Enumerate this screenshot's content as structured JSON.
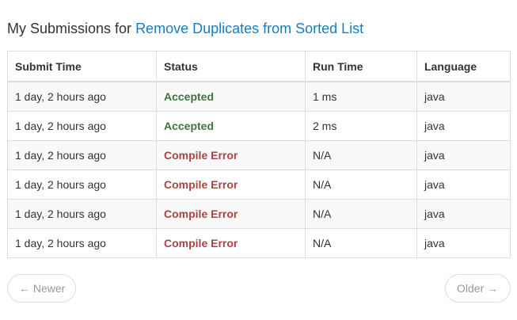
{
  "heading": {
    "prefix": "My Submissions for",
    "problem_title": "Remove Duplicates from Sorted List"
  },
  "table": {
    "columns": [
      "Submit Time",
      "Status",
      "Run Time",
      "Language"
    ],
    "rows": [
      {
        "submit_time": "1 day, 2 hours ago",
        "status": "Accepted",
        "run_time": "1 ms",
        "language": "java"
      },
      {
        "submit_time": "1 day, 2 hours ago",
        "status": "Accepted",
        "run_time": "2 ms",
        "language": "java"
      },
      {
        "submit_time": "1 day, 2 hours ago",
        "status": "Compile Error",
        "run_time": "N/A",
        "language": "java"
      },
      {
        "submit_time": "1 day, 2 hours ago",
        "status": "Compile Error",
        "run_time": "N/A",
        "language": "java"
      },
      {
        "submit_time": "1 day, 2 hours ago",
        "status": "Compile Error",
        "run_time": "N/A",
        "language": "java"
      },
      {
        "submit_time": "1 day, 2 hours ago",
        "status": "Compile Error",
        "run_time": "N/A",
        "language": "java"
      }
    ]
  },
  "pager": {
    "newer_label": "← Newer",
    "older_label": "Older →"
  },
  "colors": {
    "accepted": "#3c763d",
    "error": "#a94442",
    "link": "#1a7bbf"
  }
}
